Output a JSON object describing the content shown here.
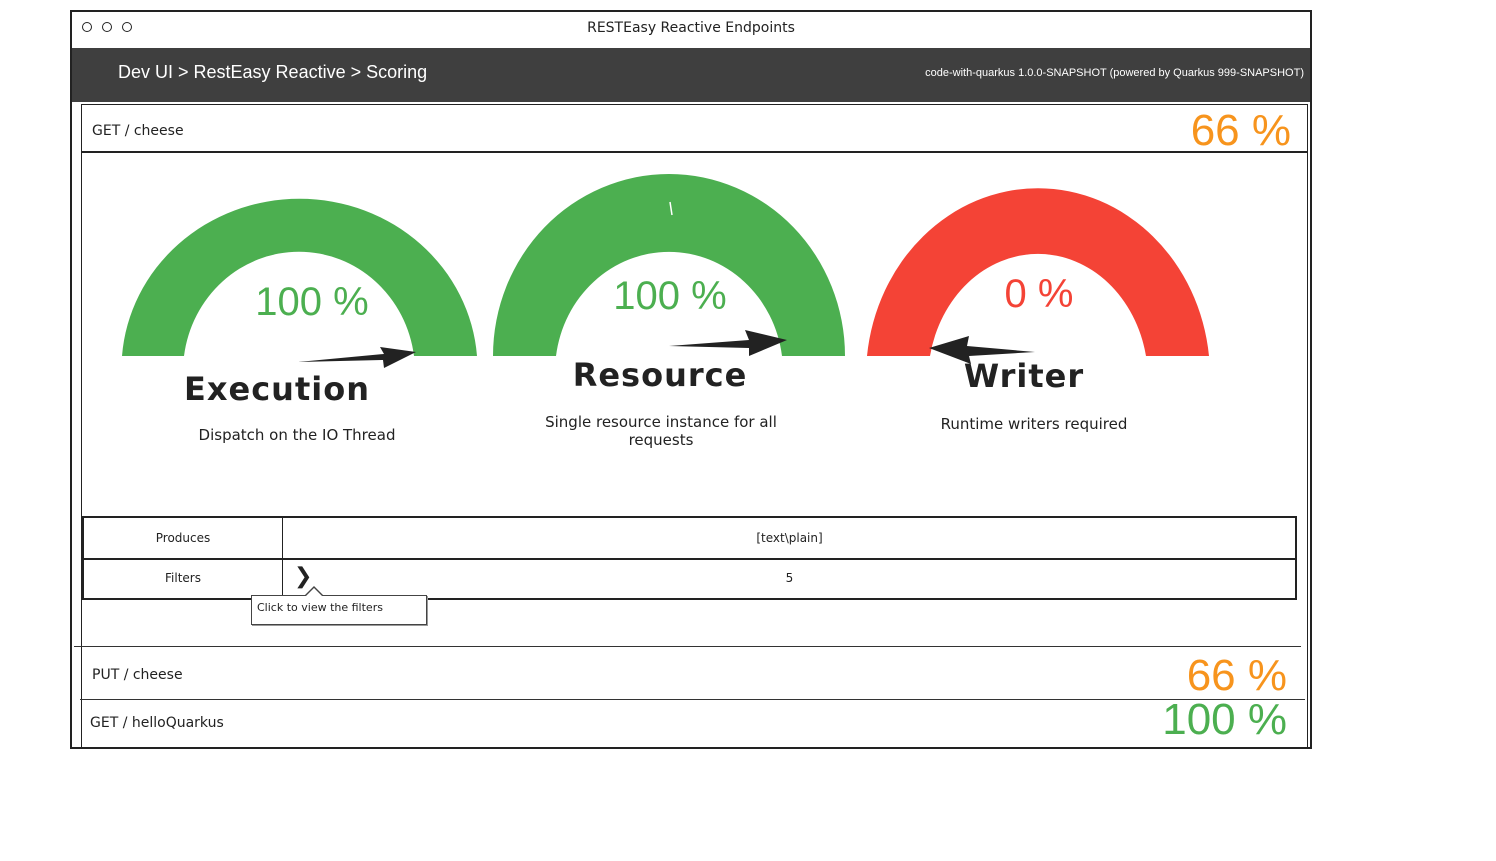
{
  "window": {
    "title": "RESTEasy Reactive Endpoints"
  },
  "topbar": {
    "breadcrumb": [
      "Dev UI",
      "RestEasy Reactive",
      "Scoring"
    ],
    "separator": ">",
    "version": "code-with-quarkus 1.0.0-SNAPSHOT (powered by Quarkus 999-SNAPSHOT)"
  },
  "colors": {
    "good": "#4caf50",
    "bad": "#f44336",
    "medium": "#f7941d",
    "topbar": "#3f3f3f"
  },
  "endpoints": [
    {
      "method_path": "GET / cheese",
      "score": "66 %",
      "score_value": 66,
      "expanded": true,
      "gauges": [
        {
          "percent_label": "100 %",
          "value": 100,
          "name": "Execution",
          "description": "Dispatch on the IO Thread",
          "color": "#4caf50"
        },
        {
          "percent_label": "100 %",
          "value": 100,
          "name": "Resource",
          "description": "Single resource instance for all requests",
          "color": "#4caf50"
        },
        {
          "percent_label": "0 %",
          "value": 0,
          "name": "Writer",
          "description": "Runtime writers required",
          "color": "#f44336"
        }
      ],
      "properties": {
        "produces_label": "Produces",
        "produces_value": "[text\\plain]",
        "filters_label": "Filters",
        "filters_value": "5",
        "filters_tooltip": "Click to view the filters",
        "expand_icon": "chevron-right-icon"
      }
    },
    {
      "method_path": "PUT / cheese",
      "score": "66 %",
      "score_value": 66,
      "expanded": false
    },
    {
      "method_path": "GET / helloQuarkus",
      "score": "100 %",
      "score_value": 100,
      "expanded": false
    }
  ]
}
